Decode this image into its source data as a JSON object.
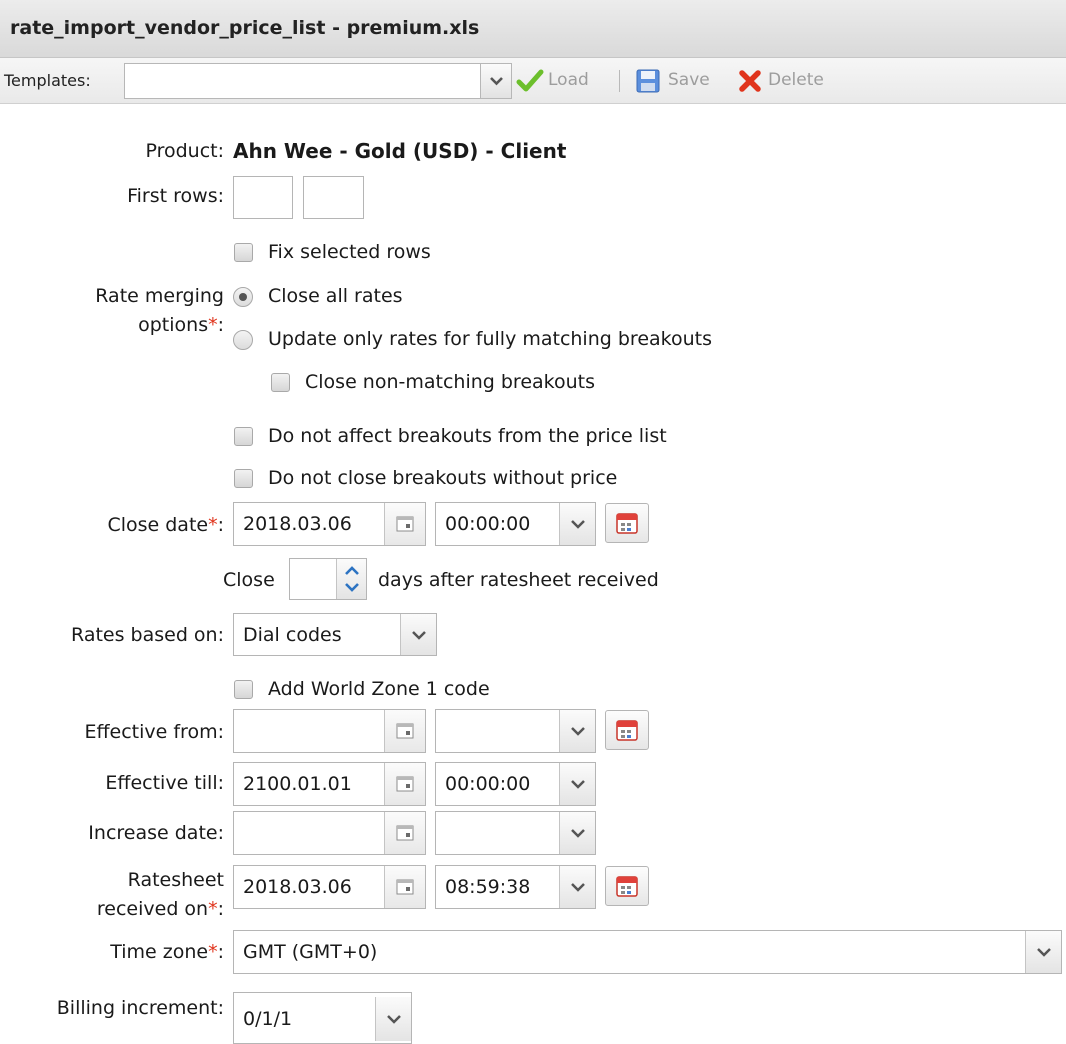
{
  "window": {
    "title": "rate_import_vendor_price_list - premium.xls"
  },
  "toolbar": {
    "templates_label": "Templates:",
    "templates_value": "",
    "load_label": "Load",
    "save_label": "Save",
    "delete_label": "Delete"
  },
  "form": {
    "product_label": "Product:",
    "product_value": "Ahn Wee - Gold (USD) - Client",
    "first_rows_label": "First rows:",
    "first_rows_from": "",
    "first_rows_to": "",
    "fix_selected_rows_label": "Fix selected rows",
    "fix_selected_rows_checked": false,
    "rate_merging_label_line1": "Rate merging",
    "rate_merging_label_line2": "options",
    "required_mark": "*",
    "colon": ":",
    "rate_merging_options": [
      {
        "label": "Close all rates",
        "selected": true
      },
      {
        "label": "Update only rates for fully matching breakouts",
        "selected": false
      }
    ],
    "close_non_matching_label": "Close non-matching breakouts",
    "close_non_matching_checked": false,
    "do_not_affect_label": "Do not affect breakouts from the price list",
    "do_not_affect_checked": false,
    "do_not_close_label": "Do not close breakouts without price",
    "do_not_close_checked": false,
    "close_date_label": "Close date",
    "close_date_value": "2018.03.06",
    "close_time_value": "00:00:00",
    "close_days_prefix": "Close",
    "close_days_value": "",
    "close_days_suffix": "days after ratesheet received",
    "rates_based_on_label": "Rates based on:",
    "rates_based_on_value": "Dial codes",
    "add_world_zone_label": "Add World Zone 1 code",
    "add_world_zone_checked": false,
    "effective_from_label": "Effective from:",
    "effective_from_date": "",
    "effective_from_time": "",
    "effective_till_label": "Effective till:",
    "effective_till_date": "2100.01.01",
    "effective_till_time": "00:00:00",
    "increase_date_label": "Increase date:",
    "increase_date_date": "",
    "increase_date_time": "",
    "ratesheet_label_line1": "Ratesheet",
    "ratesheet_label_line2": "received on",
    "ratesheet_date": "2018.03.06",
    "ratesheet_time": "08:59:38",
    "time_zone_label": "Time zone",
    "time_zone_value": "GMT (GMT+0)",
    "billing_increment_label": "Billing increment:",
    "billing_increment_value": "0/1/1"
  },
  "colors": {
    "required": "#e0341c",
    "load_check": "#6cbf2c",
    "delete_x": "#e0341c",
    "save_disk": "#4a7fd0"
  }
}
